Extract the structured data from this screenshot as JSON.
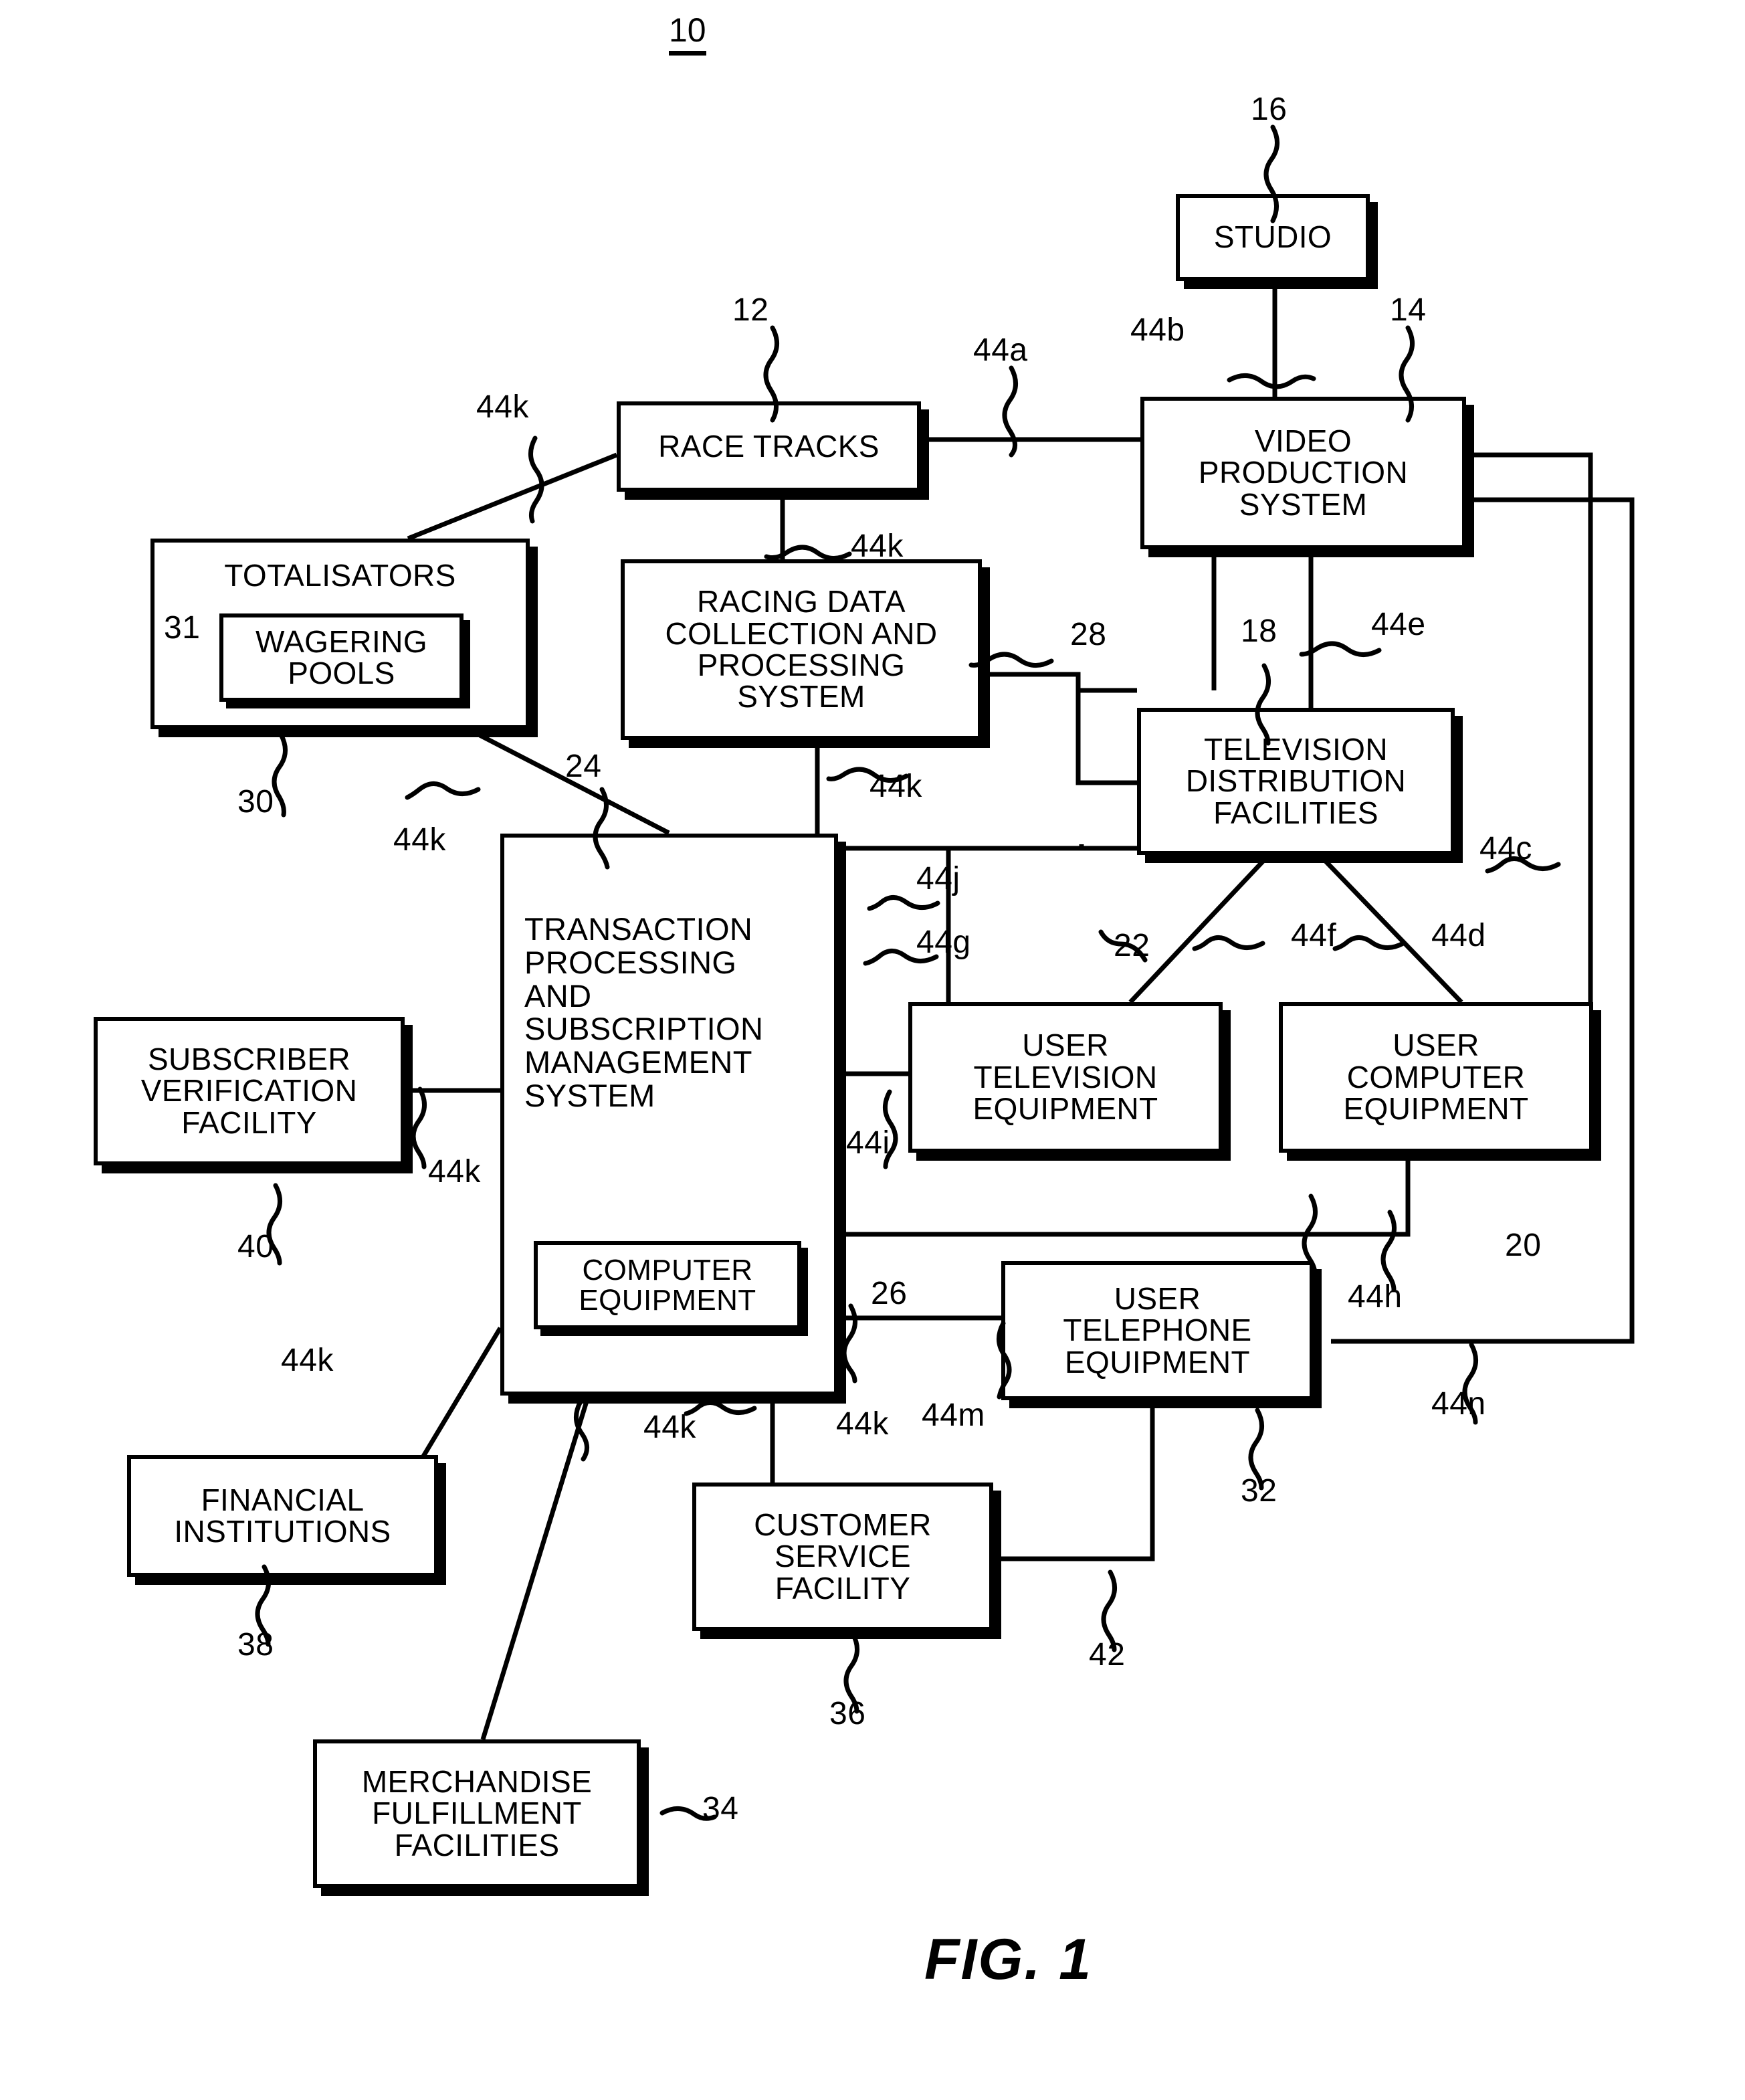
{
  "figure": {
    "system_number": "10",
    "caption": "FIG. 1"
  },
  "boxes": [
    {
      "id": "studio",
      "label": "STUDIO"
    },
    {
      "id": "race_tracks",
      "label": "RACE TRACKS"
    },
    {
      "id": "video_prod",
      "label": "VIDEO\nPRODUCTION\nSYSTEM"
    },
    {
      "id": "totalisators",
      "label": "TOTALISATORS"
    },
    {
      "id": "wagering",
      "label": "WAGERING\nPOOLS"
    },
    {
      "id": "racing_data",
      "label": "RACING DATA\nCOLLECTION AND\nPROCESSING\nSYSTEM"
    },
    {
      "id": "tv_dist",
      "label": "TELEVISION\nDISTRIBUTION\nFACILITIES"
    },
    {
      "id": "tpsms",
      "label": "TRANSACTION\nPROCESSING\nAND\nSUBSCRIPTION\nMANAGEMENT\nSYSTEM"
    },
    {
      "id": "computer_eq",
      "label": "COMPUTER\nEQUIPMENT"
    },
    {
      "id": "sub_verif",
      "label": "SUBSCRIBER\nVERIFICATION\nFACILITY"
    },
    {
      "id": "user_tv",
      "label": "USER\nTELEVISION\nEQUIPMENT"
    },
    {
      "id": "user_comp",
      "label": "USER\nCOMPUTER\nEQUIPMENT"
    },
    {
      "id": "user_phone",
      "label": "USER\nTELEPHONE\nEQUIPMENT"
    },
    {
      "id": "fin_inst",
      "label": "FINANCIAL\nINSTITUTIONS"
    },
    {
      "id": "cust_serv",
      "label": "CUSTOMER\nSERVICE\nFACILITY"
    },
    {
      "id": "merch",
      "label": "MERCHANDISE\nFULFILLMENT\nFACILITIES"
    }
  ],
  "refs": [
    {
      "id": "r16",
      "text": "16"
    },
    {
      "id": "r12",
      "text": "12"
    },
    {
      "id": "r14",
      "text": "14"
    },
    {
      "id": "r44a",
      "text": "44a"
    },
    {
      "id": "r44b",
      "text": "44b"
    },
    {
      "id": "r44k1",
      "text": "44k"
    },
    {
      "id": "r44k2",
      "text": "44k"
    },
    {
      "id": "r31",
      "text": "31"
    },
    {
      "id": "r28",
      "text": "28"
    },
    {
      "id": "r18",
      "text": "18"
    },
    {
      "id": "r44e",
      "text": "44e"
    },
    {
      "id": "r30",
      "text": "30"
    },
    {
      "id": "r44k3",
      "text": "44k"
    },
    {
      "id": "r24",
      "text": "24"
    },
    {
      "id": "r44k4",
      "text": "44k"
    },
    {
      "id": "r44j",
      "text": "44j"
    },
    {
      "id": "r44g",
      "text": "44g"
    },
    {
      "id": "r22",
      "text": "22"
    },
    {
      "id": "r44f",
      "text": "44f"
    },
    {
      "id": "r44d",
      "text": "44d"
    },
    {
      "id": "r44c",
      "text": "44c"
    },
    {
      "id": "r44i",
      "text": "44i"
    },
    {
      "id": "r44k5",
      "text": "44k"
    },
    {
      "id": "r40",
      "text": "40"
    },
    {
      "id": "r20",
      "text": "20"
    },
    {
      "id": "r44h",
      "text": "44h"
    },
    {
      "id": "r26",
      "text": "26"
    },
    {
      "id": "r44n",
      "text": "44n"
    },
    {
      "id": "r44k6",
      "text": "44k"
    },
    {
      "id": "r44k7",
      "text": "44k"
    },
    {
      "id": "r44k8",
      "text": "44k"
    },
    {
      "id": "r44m",
      "text": "44m"
    },
    {
      "id": "r32",
      "text": "32"
    },
    {
      "id": "r38",
      "text": "38"
    },
    {
      "id": "r42",
      "text": "42"
    },
    {
      "id": "r36",
      "text": "36"
    },
    {
      "id": "r34",
      "text": "34"
    }
  ]
}
